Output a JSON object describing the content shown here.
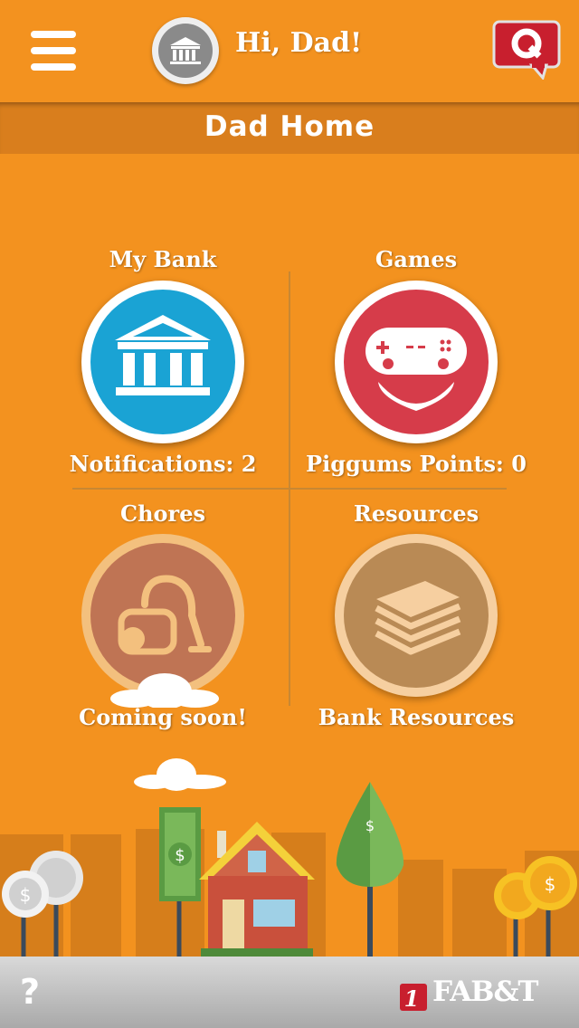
{
  "header": {
    "greeting": "Hi, Dad!",
    "menu_icon": "hamburger-menu-icon",
    "avatar_icon": "bank-building-icon",
    "q_button_icon": "q-chat-bubble-icon"
  },
  "title_bar": {
    "title": "Dad Home"
  },
  "tiles": [
    {
      "label": "My Bank",
      "caption": "Notifications: 2",
      "icon": "bank-building-icon",
      "color": "#1aa3d4"
    },
    {
      "label": "Games",
      "caption": "Piggums Points: 0",
      "icon": "game-controller-icon",
      "color": "#d63c4a"
    },
    {
      "label": "Chores",
      "caption": "Coming soon!",
      "icon": "vacuum-cleaner-icon",
      "color": "#b76f5e"
    },
    {
      "label": "Resources",
      "caption": "Bank Resources",
      "icon": "stacked-books-icon",
      "color": "#b98a55"
    }
  ],
  "footer": {
    "help_label": "?",
    "brand": "FAB&T",
    "brand_mark": "1st"
  },
  "colors": {
    "background": "#f3921f",
    "title_bar": "#d97e1d",
    "footer": "#b8b8b8"
  }
}
